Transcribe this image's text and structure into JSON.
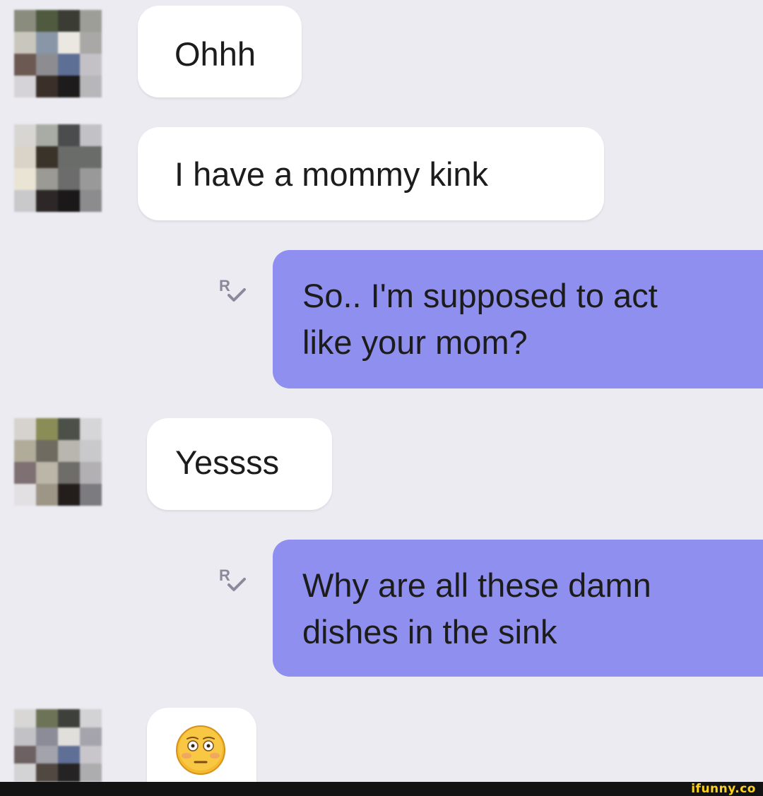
{
  "conversation": {
    "messages": [
      {
        "direction": "incoming",
        "text": "Ohhh"
      },
      {
        "direction": "incoming",
        "text": "I have a mommy kink"
      },
      {
        "direction": "outgoing",
        "lines": [
          "So.. I'm supposed to act",
          "like your mom?"
        ],
        "receipt_label": "R"
      },
      {
        "direction": "incoming",
        "text": "Yessss"
      },
      {
        "direction": "outgoing",
        "lines": [
          "Why are all these damn",
          "dishes in the sink"
        ],
        "receipt_label": "R"
      },
      {
        "direction": "incoming",
        "emoji": "flushed-face"
      }
    ]
  },
  "theme": {
    "background": "#ebebf1",
    "incoming_bubble": "#ffffff",
    "outgoing_bubble": "#8f8ff0",
    "receipt_color": "#8a8a9a"
  },
  "watermark": {
    "text": "ifunny.co"
  }
}
